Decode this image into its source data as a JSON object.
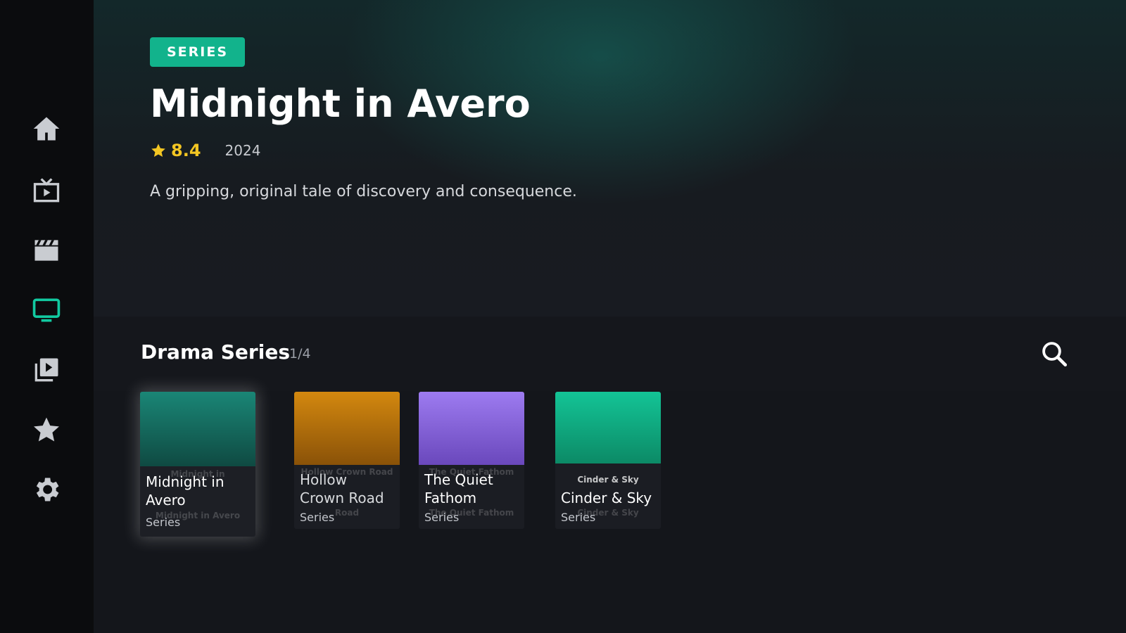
{
  "nav": {
    "items": [
      {
        "icon": "home-icon"
      },
      {
        "icon": "live-tv-icon"
      },
      {
        "icon": "movies-clapper-icon"
      },
      {
        "icon": "series-tv-icon",
        "active": true
      },
      {
        "icon": "media-library-icon"
      },
      {
        "icon": "favorites-star-icon"
      },
      {
        "icon": "settings-gear-icon"
      }
    ],
    "active_color": "#12c9a0",
    "icon_color": "#c9ccd1"
  },
  "hero": {
    "badge": "SERIES",
    "title": "Midnight in Avero",
    "rating": "8.4",
    "year": "2024",
    "description": "A gripping, original tale of discovery and consequence."
  },
  "row": {
    "title": "Drama Series",
    "count": "1/4",
    "search_icon": "search-icon"
  },
  "cards": [
    {
      "title": "Midnight in Avero",
      "ghost_top": "Midnight in",
      "ghost_bottom": "Midnight in Avero",
      "type": "Series",
      "color_top": "#1a8676",
      "color_bottom": "#0f4a42",
      "focused": true
    },
    {
      "title": "Hollow Crown Road",
      "ghost_top": "Hollow Crown Road",
      "ghost_bottom": "Road",
      "type": "Series",
      "color_top": "#d3880f",
      "color_bottom": "#8a5208"
    },
    {
      "title": "The Quiet Fathom",
      "ghost_top": "The Quiet Fathom",
      "ghost_bottom": "The Quiet Fathom",
      "type": "Series",
      "color_top": "#9d7bf0",
      "color_bottom": "#6a48bc"
    },
    {
      "title": "Cinder & Sky",
      "ghost_top": "Cinder & Sky",
      "ghost_bottom": "Cinder & Sky",
      "type": "Series",
      "color_top": "#13c496",
      "color_bottom": "#0c8a66"
    }
  ]
}
